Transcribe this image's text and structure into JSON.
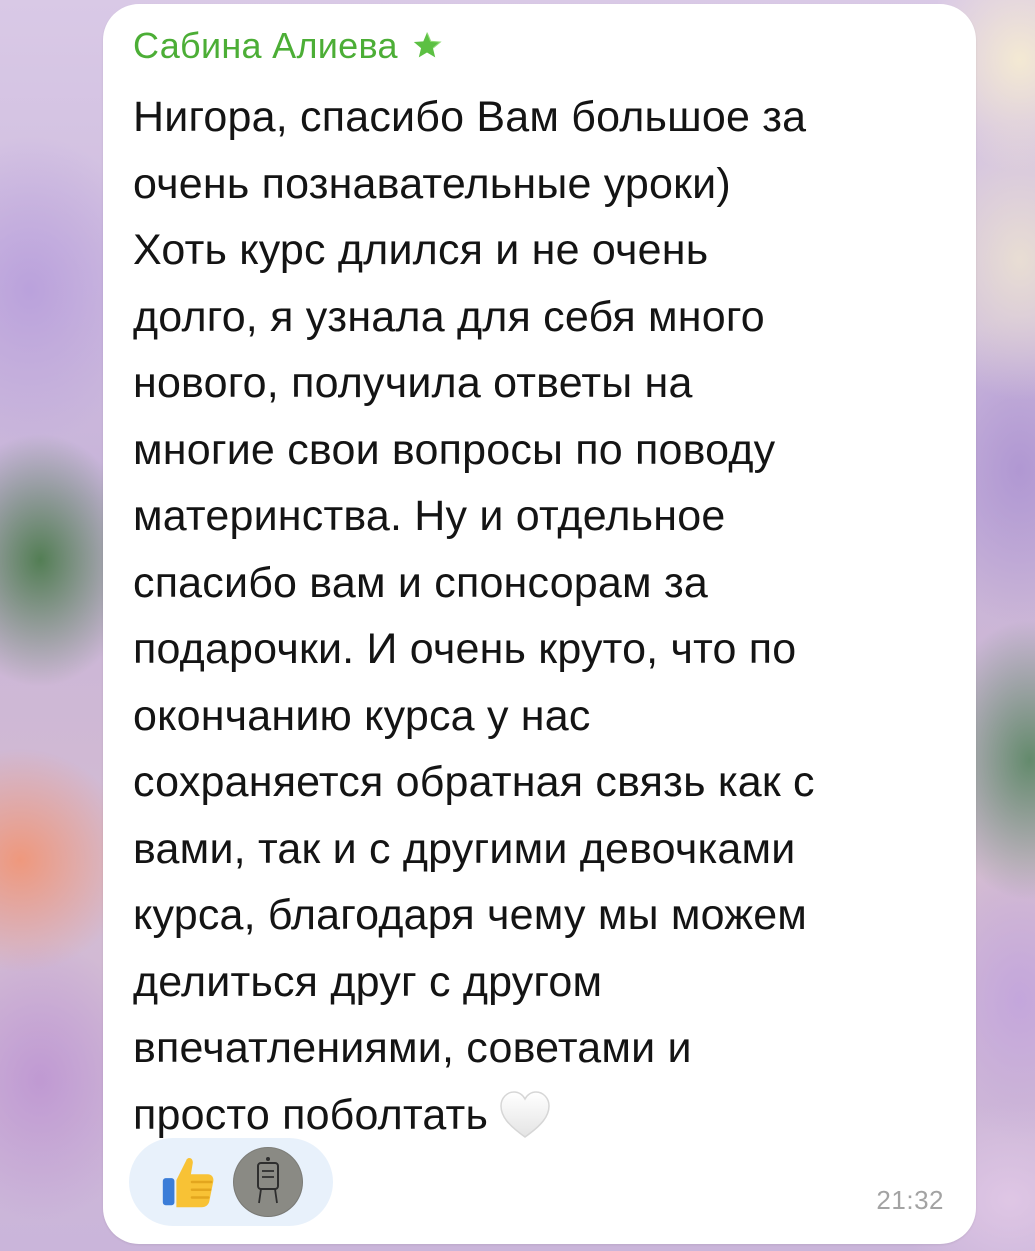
{
  "message": {
    "sender_name": "Сабина Алиева",
    "sender_badge_icon": "star-icon",
    "lines": [
      "Нигора, спасибо Вам большое за",
      "очень познавательные уроки)",
      "Хоть курс длился и не очень",
      "долго, я узнала для себя много",
      "нового, получила ответы на",
      "многие свои вопросы по поводу",
      "материнства. Ну и отдельное",
      "спасибо вам и спонсорам за",
      "подарочки. И очень круто, что по",
      "окончанию курса у нас",
      "сохраняется обратная связь как с",
      "вами, так и с другими девочками",
      "курса, благодаря чему мы можем",
      "делиться друг с другом",
      "впечатлениями, советами и",
      "просто поболтать"
    ],
    "trailing_emoji": "white-heart-icon",
    "time": "21:32",
    "reaction": {
      "emoji": "thumbs-up-icon",
      "reactor": "avatar"
    }
  },
  "colors": {
    "sender_name": "#4cae36",
    "bubble": "#ffffff",
    "text": "#141414",
    "time": "#a3a3a3",
    "reaction_pill": "#e8f1fb"
  }
}
